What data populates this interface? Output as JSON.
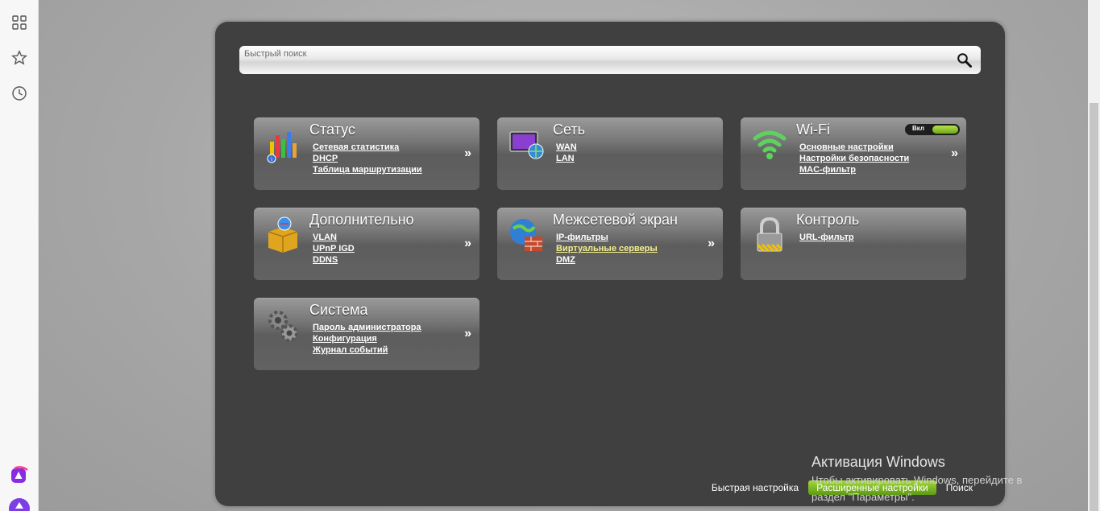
{
  "search": {
    "placeholder": "Быстрый поиск"
  },
  "tiles": [
    {
      "title": "Статус",
      "links": [
        "Сетевая статистика",
        "DHCP",
        "Таблица маршрутизации"
      ],
      "more": "»"
    },
    {
      "title": "Сеть",
      "links": [
        "WAN",
        "LAN"
      ]
    },
    {
      "title": "Wi-Fi",
      "links": [
        "Основные настройки",
        "Настройки безопасности",
        "MAC-фильтр"
      ],
      "more": "»",
      "toggle": "Вкл"
    },
    {
      "title": "Дополнительно",
      "links": [
        "VLAN",
        "UPnP IGD",
        "DDNS"
      ],
      "more": "»"
    },
    {
      "title": "Межсетевой экран",
      "links": [
        "IP-фильтры",
        "Виртуальные серверы",
        "DMZ"
      ],
      "more": "»"
    },
    {
      "title": "Контроль",
      "links": [
        "URL-фильтр"
      ]
    },
    {
      "title": "Система",
      "links": [
        "Пароль администратора",
        "Конфигурация",
        "Журнал событий"
      ],
      "more": "»"
    }
  ],
  "bottom_nav": {
    "quick": "Быстрая настройка",
    "advanced": "Расширенные настройки",
    "search": "Поиск"
  },
  "watermark": {
    "title": "Активация Windows",
    "line1": "Чтобы активировать Windows, перейдите в",
    "line2": "раздел \"Параметры\"."
  },
  "icons": {
    "sidebar": [
      "apps-grid-icon",
      "star-icon",
      "history-clock-icon",
      "alice-assistant-icon",
      "alice-logo-icon"
    ],
    "search": "magnifier-icon"
  },
  "colors": {
    "accent": "#8cc63f",
    "active_link": "#f2ef8f",
    "panel": "#404040",
    "loading": "#f5c518"
  }
}
